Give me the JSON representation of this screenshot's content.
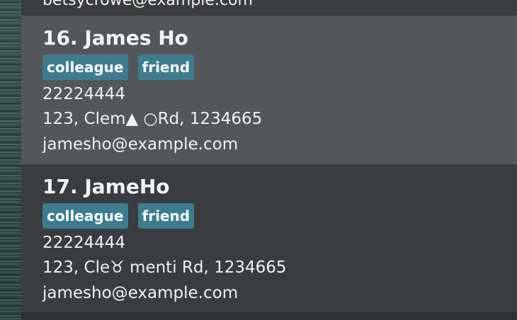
{
  "list": {
    "previous_email_fragment": "betsycrowe@example.com",
    "cards": [
      {
        "name_line": "16.  James Ho",
        "tags": [
          "colleague",
          "friend"
        ],
        "phone": "22224444",
        "address": "123, Clem▲ ○Rd, 1234665",
        "email": "jamesho@example.com"
      },
      {
        "name_line": "17.  JameHo",
        "tags": [
          "colleague",
          "friend"
        ],
        "phone": "22224444",
        "address": "123, Cle♉ menti Rd, 1234665",
        "email": "jamesho@example.com"
      }
    ]
  },
  "colors": {
    "selected_card_bg": "#53575a",
    "card_bg": "#3a3d3f",
    "tag_bg": "#3d7c8f",
    "text": "#f0f0f0"
  }
}
